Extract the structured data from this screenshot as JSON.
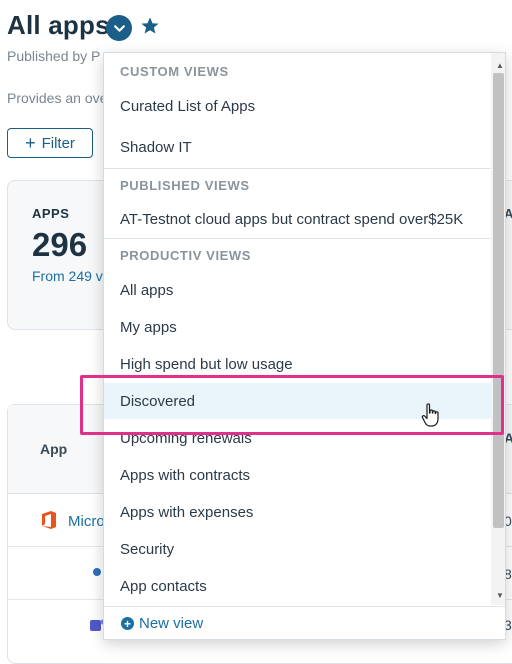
{
  "page": {
    "title": "All apps",
    "published_by": "Published by P",
    "description": "Provides an ove",
    "filter_label": "Filter"
  },
  "stats": {
    "label": "APPS",
    "value": "296",
    "sub": "From 249 v"
  },
  "table": {
    "column_app": "App",
    "first_app": "Micro",
    "right_values": [
      "A",
      "0",
      "8",
      "3"
    ]
  },
  "dropdown": {
    "sections": [
      {
        "title": "CUSTOM VIEWS",
        "items": [
          "Curated List of Apps",
          "Shadow IT"
        ]
      },
      {
        "title": "PUBLISHED VIEWS",
        "items": [
          "AT-Testnot cloud apps but contract spend over$25K"
        ]
      },
      {
        "title": "PRODUCTIV VIEWS",
        "items": [
          "All apps",
          "My apps",
          "High spend but low usage",
          "Discovered",
          "Upcoming renewals",
          "Apps with contracts",
          "Apps with expenses",
          "Security",
          "App contacts"
        ]
      }
    ],
    "hovered_item": "Discovered",
    "new_view_label": "New view"
  },
  "colors": {
    "primary": "#1b5e88",
    "link": "#1b6fa3",
    "highlight": "#e0308a",
    "hover_bg": "#eaf5fb",
    "office_orange": "#e8531e"
  },
  "icons": {
    "views_toggle": "chevron-down-icon",
    "favorite": "star-icon",
    "filter": "plus-icon",
    "new_view": "plus-circle-icon",
    "cursor": "hand-pointer-icon"
  }
}
